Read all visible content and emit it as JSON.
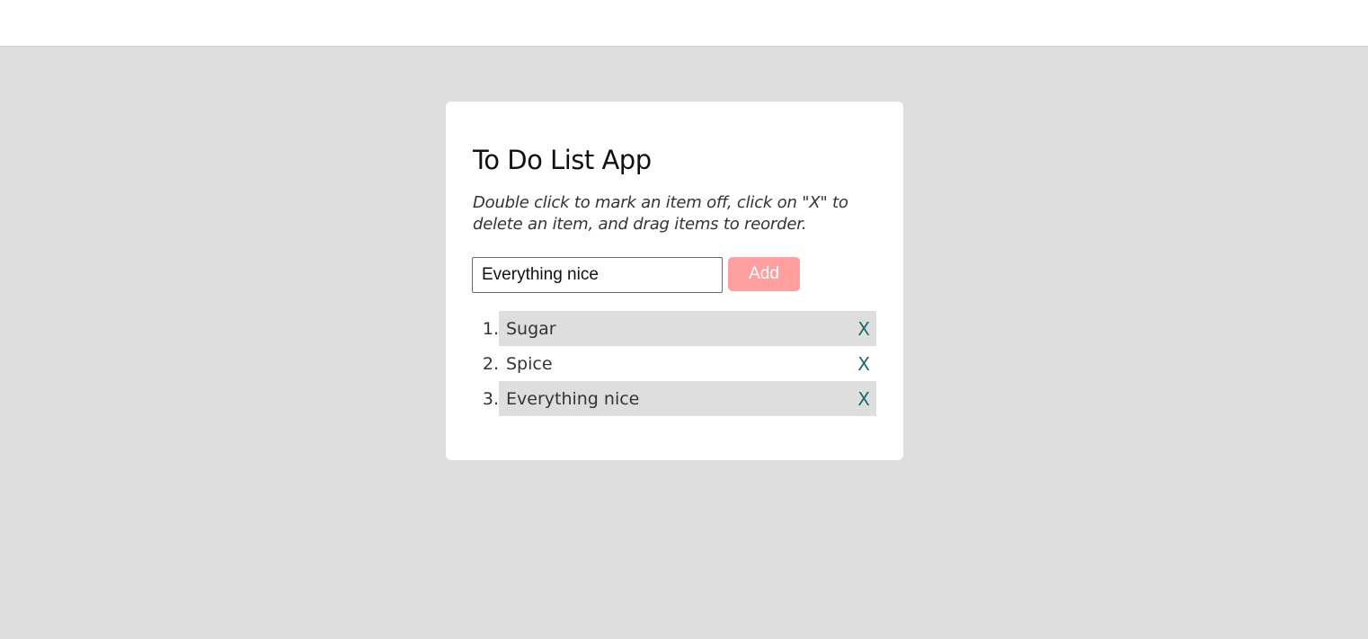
{
  "app": {
    "title": "To Do List App",
    "instructions": "Double click to mark an item off, click on \"X\" to delete an item, and drag items to reorder."
  },
  "form": {
    "input_value": "Everything nice",
    "add_label": "Add"
  },
  "todos": [
    {
      "number": "1.",
      "text": "Sugar",
      "delete_label": "X"
    },
    {
      "number": "2.",
      "text": "Spice",
      "delete_label": "X"
    },
    {
      "number": "3.",
      "text": "Everything nice",
      "delete_label": "X"
    }
  ],
  "colors": {
    "page_background": "#dedede",
    "card_background": "#ffffff",
    "add_button": "#ff9f9f",
    "delete_x": "#1d6a6b",
    "shaded_row": "#dedede"
  }
}
